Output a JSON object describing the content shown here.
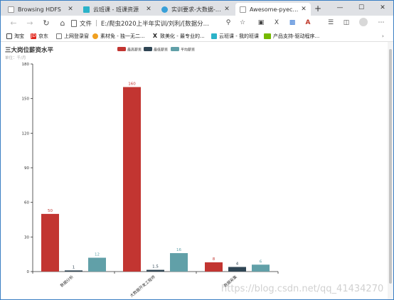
{
  "browser": {
    "tabs": [
      {
        "title": "Browsing HDFS",
        "favicon": "page-icon",
        "active": false
      },
      {
        "title": "云班课 - 班课资源",
        "favicon": "cloud-class-icon",
        "active": false
      },
      {
        "title": "实训要求-大数据-hive+python",
        "favicon": "cloud-doc-icon",
        "active": false
      },
      {
        "title": "Awesome-pyecharts",
        "favicon": "page-icon",
        "active": true
      }
    ],
    "new_tab": "+",
    "window_controls": {
      "minimize": "—",
      "maximize": "☐",
      "close": "✕"
    },
    "address": {
      "scheme_label": "文件",
      "path": "E:/爬虫2020上半年实训/刘利/[数据分..."
    },
    "bookmarks": [
      {
        "label": "淘宝",
        "icon": "taobao-icon",
        "color": "#ff5000"
      },
      {
        "label": "京东",
        "icon": "jd-icon",
        "color": "#e1251b"
      },
      {
        "label": "上网登录窗",
        "icon": "page-icon",
        "color": "#888888"
      },
      {
        "label": "素材免 - 独一无二...",
        "icon": "material-icon",
        "color": "#f0a020"
      },
      {
        "label": "致美化 - 最专业的...",
        "icon": "zhimeihua-icon",
        "color": "#222222"
      },
      {
        "label": "云班课 - 我的班课",
        "icon": "cloud-class-icon",
        "color": "#2bb3c9"
      },
      {
        "label": "产品支持-驱动程序...",
        "icon": "nvidia-icon",
        "color": "#76b900"
      }
    ]
  },
  "chart_data": {
    "type": "bar",
    "title": "三大岗位薪资水平",
    "subtitle": "单位：千/月",
    "categories": [
      "数据分析",
      "大数据开发工程师",
      "数据采集"
    ],
    "series": [
      {
        "name": "最高薪资",
        "color": "#c23531",
        "values": [
          50,
          160,
          8
        ]
      },
      {
        "name": "最低薪资",
        "color": "#2f4554",
        "values": [
          1,
          1.5,
          4
        ]
      },
      {
        "name": "平均薪资",
        "color": "#61a0a8",
        "values": [
          12,
          16,
          6
        ]
      }
    ],
    "ylim": [
      0,
      180
    ],
    "yticks": [
      0,
      30,
      60,
      90,
      120,
      150,
      180
    ],
    "legend_position": "top-center",
    "grid": false
  },
  "watermark": "https://blog.csdn.net/qq_41434270"
}
